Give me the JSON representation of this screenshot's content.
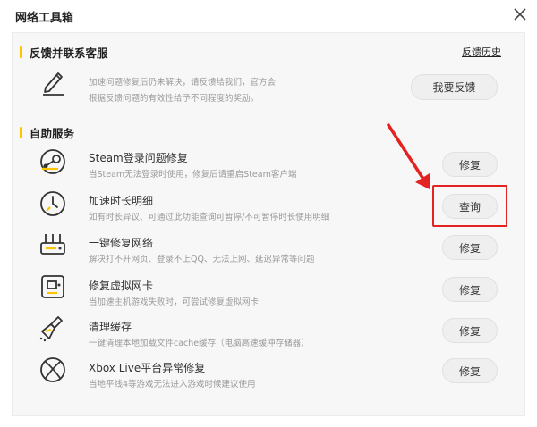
{
  "window": {
    "title": "网络工具箱"
  },
  "feedback": {
    "section_title": "反馈并联系客服",
    "history_link": "反馈历史",
    "line1": "加速问题修复后仍未解决，请反馈给我们，官方会",
    "line2": "根据反馈问题的有效性给予不同程度的奖励。",
    "button": "我要反馈"
  },
  "self_service": {
    "section_title": "自助服务",
    "items": [
      {
        "title": "Steam登录问题修复",
        "desc": "当Steam无法登录时使用，修复后请重启Steam客户端",
        "button": "修复"
      },
      {
        "title": "加速时长明细",
        "desc": "如有时长异议、可通过此功能查询可暂停/不可暂停时长使用明细",
        "button": "查询"
      },
      {
        "title": "一键修复网络",
        "desc": "解决打不开网页、登录不上QQ、无法上网、延迟异常等问题",
        "button": "修复"
      },
      {
        "title": "修复虚拟网卡",
        "desc": "当加速主机游戏失败时，可尝试修复虚拟网卡",
        "button": "修复"
      },
      {
        "title": "清理缓存",
        "desc": "一键清理本地加载文件cache缓存（电脑高速缓冲存储器）",
        "button": "修复"
      },
      {
        "title": "Xbox Live平台异常修复",
        "desc": "当地平线4等游戏无法进入游戏时候建议使用",
        "button": "修复"
      }
    ]
  },
  "colors": {
    "accent": "#ffc400",
    "annotation": "#e32222"
  }
}
